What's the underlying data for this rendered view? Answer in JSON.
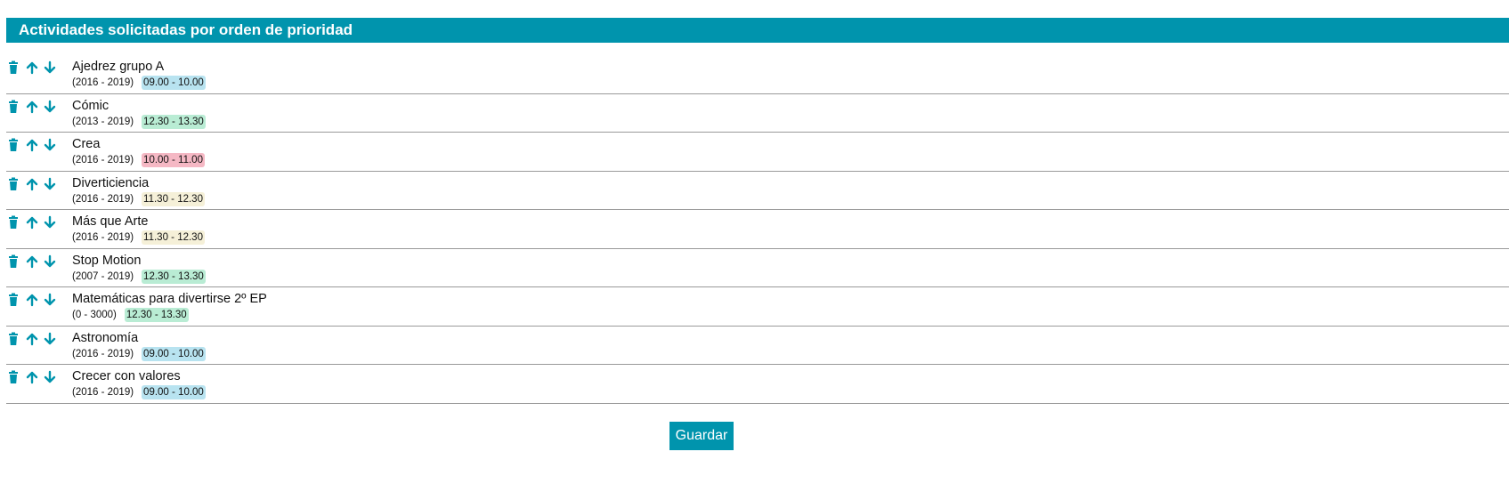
{
  "header": {
    "title": "Actividades solicitadas por orden de prioridad"
  },
  "colors": {
    "accent": "#0094ad",
    "slot_morning_early": "#b8e3f0",
    "slot_midday": "#b9ecd4",
    "slot_late_morning": "#f5f0d8",
    "slot_mid_morning": "#f5b8c4"
  },
  "icons": {
    "delete": "trash-icon",
    "move_up": "arrow-up-icon",
    "move_down": "arrow-down-icon"
  },
  "activities": [
    {
      "name": "Ajedrez grupo A",
      "years": "(2016 - 2019)",
      "schedule": "09.00 - 10.00",
      "color": "#b8e3f0"
    },
    {
      "name": "Cómic",
      "years": "(2013 - 2019)",
      "schedule": "12.30 - 13.30",
      "color": "#b9ecd4"
    },
    {
      "name": "Crea",
      "years": "(2016 - 2019)",
      "schedule": "10.00 - 11.00",
      "color": "#f5b8c4"
    },
    {
      "name": "Diverticiencia",
      "years": "(2016 - 2019)",
      "schedule": "11.30 - 12.30",
      "color": "#f5f0d8"
    },
    {
      "name": "Más que Arte",
      "years": "(2016 - 2019)",
      "schedule": "11.30 - 12.30",
      "color": "#f5f0d8"
    },
    {
      "name": "Stop Motion",
      "years": "(2007 - 2019)",
      "schedule": "12.30 - 13.30",
      "color": "#b9ecd4"
    },
    {
      "name": "Matemáticas para divertirse 2º EP",
      "years": "(0 - 3000)",
      "schedule": "12.30 - 13.30",
      "color": "#b9ecd4"
    },
    {
      "name": "Astronomía",
      "years": "(2016 - 2019)",
      "schedule": "09.00 - 10.00",
      "color": "#b8e3f0"
    },
    {
      "name": "Crecer con valores",
      "years": "(2016 - 2019)",
      "schedule": "09.00 - 10.00",
      "color": "#b8e3f0"
    }
  ],
  "actions": {
    "save_label": "Guardar"
  }
}
